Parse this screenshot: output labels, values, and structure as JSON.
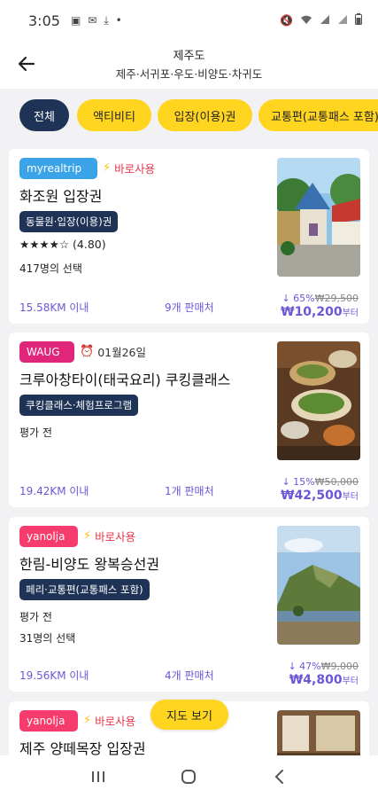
{
  "status_bar": {
    "time": "3:05"
  },
  "header": {
    "title": "제주도",
    "subtitle": "제주·서귀포·우도·비양도·차귀도"
  },
  "chips": [
    "전체",
    "액티비티",
    "입장(이용)권",
    "교통편(교통패스 포함)"
  ],
  "cards": [
    {
      "provider": "myrealtrip",
      "tag": "바로사용",
      "title": "화조원 입장권",
      "category": "동물원·입장(이용)권",
      "stars": "★★★★☆",
      "rating": "(4.80)",
      "selections": "417명의 선택",
      "distance": "15.58KM 이내",
      "sellers": "9개 판매처",
      "discount_pct": "↓ 65%",
      "orig_price": "₩29,500",
      "price": "₩10,200",
      "price_suffix": "부터"
    },
    {
      "provider": "WAUG",
      "tag": "01월26일",
      "title": "크루아창타이(태국요리) 쿠킹클래스",
      "category": "쿠킹클래스·체험프로그램",
      "review": "평가 전",
      "distance": "19.42KM 이내",
      "sellers": "1개 판매처",
      "discount_pct": "↓ 15%",
      "orig_price": "₩50,000",
      "price": "₩42,500",
      "price_suffix": "부터"
    },
    {
      "provider": "yanolja",
      "tag": "바로사용",
      "title": "한림-비양도 왕복승선권",
      "category": "페리·교통편(교통패스 포함)",
      "review": "평가 전",
      "selections": "31명의 선택",
      "distance": "19.56KM 이내",
      "sellers": "4개 판매처",
      "discount_pct": "↓ 47%",
      "orig_price": "₩9,000",
      "price": "₩4,800",
      "price_suffix": "부터"
    },
    {
      "provider": "yanolja",
      "tag": "바로사용",
      "title": "제주 양떼목장 입장권"
    }
  ],
  "map_button": "지도 보기",
  "colors": {
    "navy": "#1f3356",
    "yellow": "#ffd51f",
    "purple": "#6b57d8",
    "red": "#e8364b"
  }
}
